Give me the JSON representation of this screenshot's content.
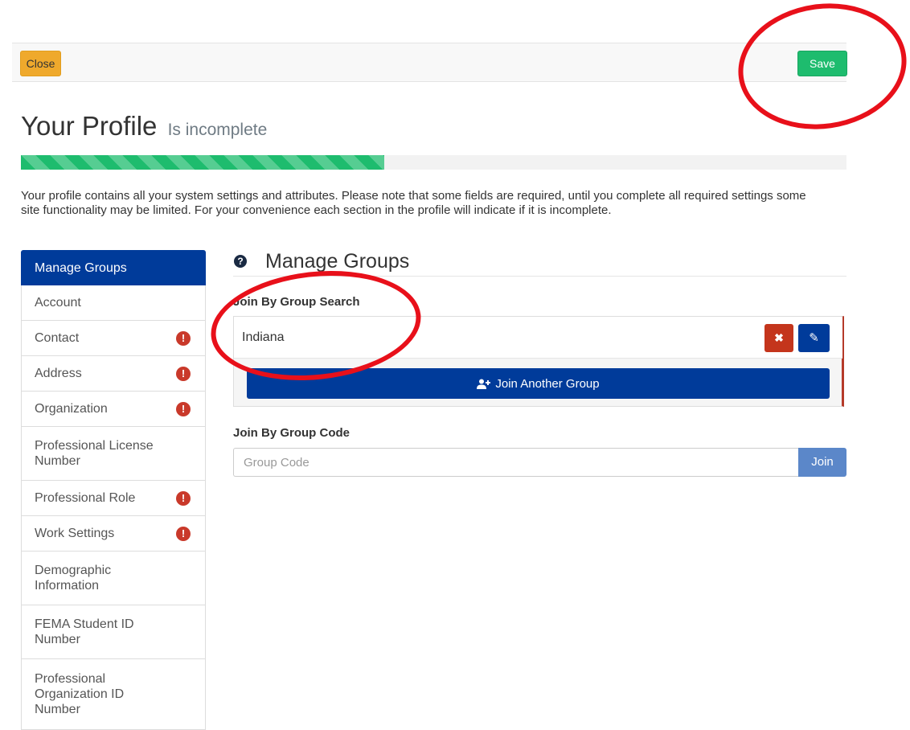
{
  "toolbar": {
    "close_label": "Close",
    "save_label": "Save"
  },
  "header": {
    "title": "Your Profile",
    "subtitle": "Is incomplete"
  },
  "progress": {
    "fraction": 0.44
  },
  "intro_text": "Your profile contains all your system settings and attributes. Please note that some fields are required, until you complete all required settings some site functionality may be limited. For your convenience each section in the profile will indicate if it is incomplete.",
  "sidebar": {
    "items": [
      {
        "label": "Manage Groups",
        "active": true,
        "warning": false
      },
      {
        "label": "Account",
        "active": false,
        "warning": false
      },
      {
        "label": "Contact",
        "active": false,
        "warning": true
      },
      {
        "label": "Address",
        "active": false,
        "warning": true
      },
      {
        "label": "Organization",
        "active": false,
        "warning": true
      },
      {
        "label": "Professional License Number",
        "active": false,
        "warning": false
      },
      {
        "label": "Professional Role",
        "active": false,
        "warning": true
      },
      {
        "label": "Work Settings",
        "active": false,
        "warning": true
      },
      {
        "label": "Demographic Information",
        "active": false,
        "warning": false
      },
      {
        "label": "FEMA Student ID Number",
        "active": false,
        "warning": false
      },
      {
        "label": "Professional Organization ID Number",
        "active": false,
        "warning": false
      }
    ],
    "warning_glyph": "!"
  },
  "main": {
    "section_title": "Manage Groups",
    "help_glyph": "?",
    "search_heading": "Join By Group Search",
    "joined_group": "Indiana",
    "remove_glyph": "✖",
    "edit_glyph": "✎",
    "join_another_label": "Join Another Group",
    "join_another_icon": "user-plus-icon",
    "code_heading": "Join By Group Code",
    "code_placeholder": "Group Code",
    "code_value": "",
    "join_label": "Join"
  },
  "colors": {
    "primary": "#003b9a",
    "success": "#1ebc6e",
    "warning": "#efa92c",
    "danger": "#c9392a",
    "annotation": "#e8101a"
  }
}
